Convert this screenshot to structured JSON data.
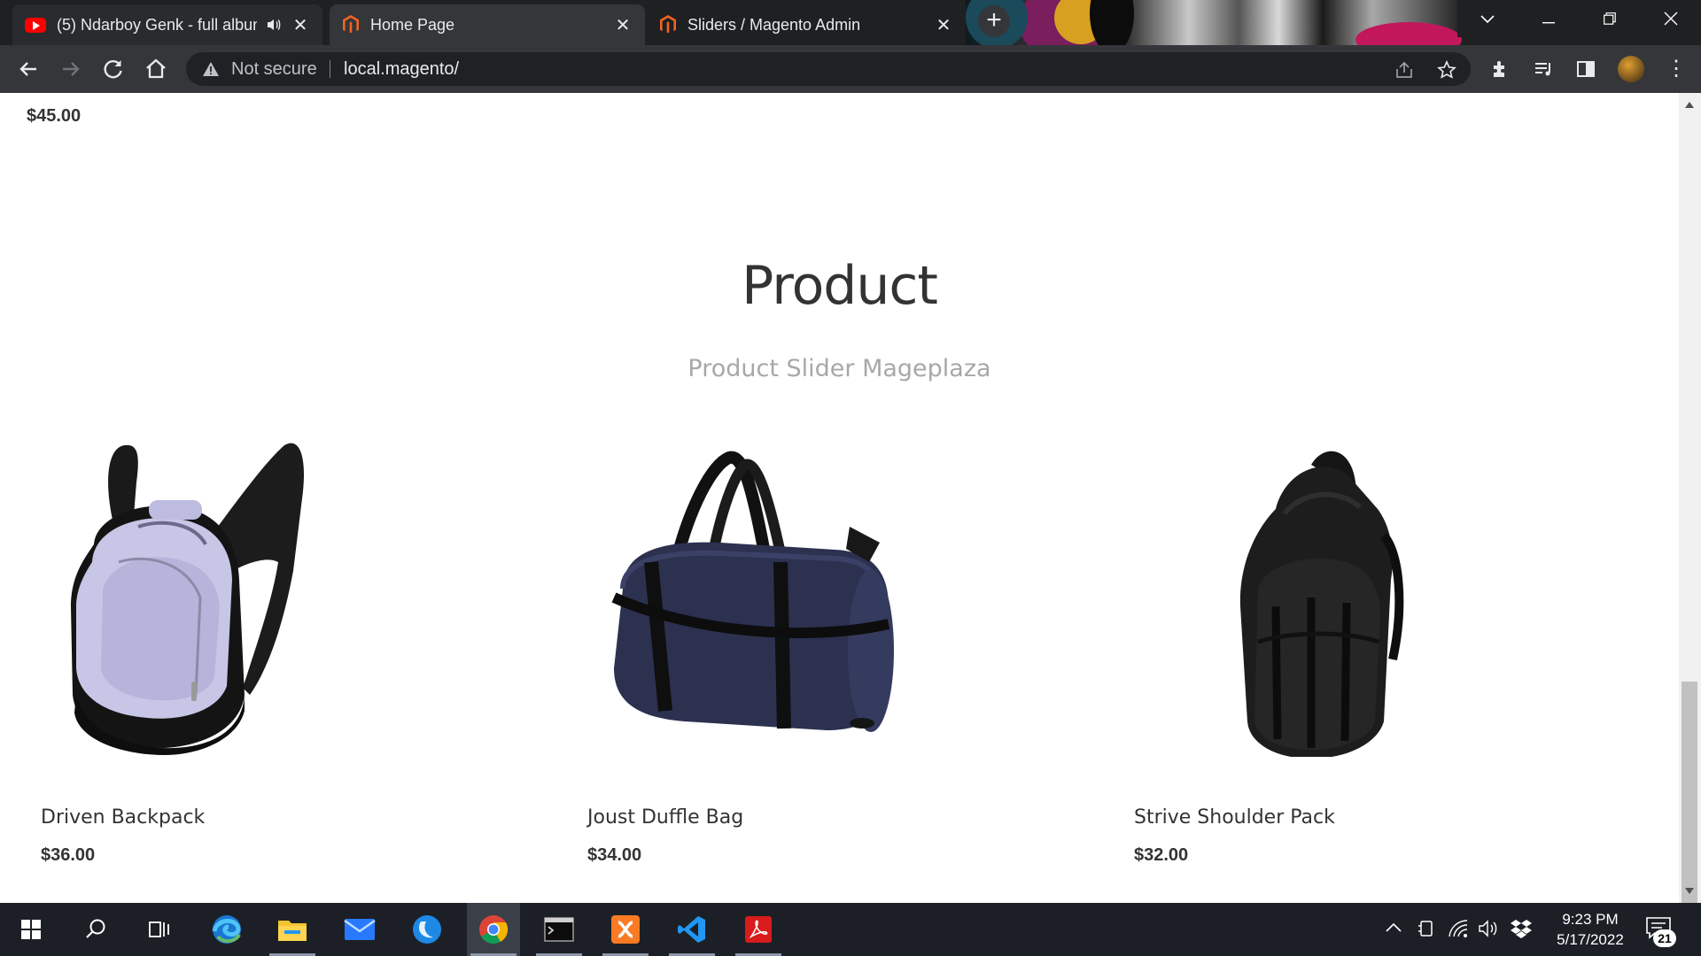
{
  "browser": {
    "tabs": [
      {
        "title": "(5) Ndarboy Genk - full albun",
        "icon": "youtube-icon",
        "audio": true
      },
      {
        "title": "Home Page",
        "icon": "magento-icon",
        "active": true
      },
      {
        "title": "Sliders / Magento Admin",
        "icon": "magento-icon"
      }
    ],
    "security_label": "Not secure",
    "url": "local.magento/"
  },
  "page": {
    "top_price": "$45.00",
    "section_title": "Product",
    "section_subtitle": "Product Slider Mageplaza",
    "products": [
      {
        "name": "Driven Backpack",
        "price": "$36.00",
        "image": "backpack-image"
      },
      {
        "name": "Joust Duffle Bag",
        "price": "$34.00",
        "image": "duffle-bag-image"
      },
      {
        "name": "Strive Shoulder Pack",
        "price": "$32.00",
        "image": "shoulder-pack-image"
      }
    ]
  },
  "taskbar": {
    "apps": [
      "start",
      "search",
      "task-view",
      "edge",
      "file-explorer",
      "mail",
      "app-blue",
      "chrome",
      "terminal",
      "xampp",
      "vscode",
      "acrobat"
    ],
    "time": "9:23 PM",
    "date": "5/17/2022",
    "notification_count": "21"
  },
  "colors": {
    "tabstrip_bg": "#1f2022",
    "toolbar_bg": "#35363a",
    "magento_orange": "#f26322",
    "taskbar_bg": "#1c2026"
  }
}
